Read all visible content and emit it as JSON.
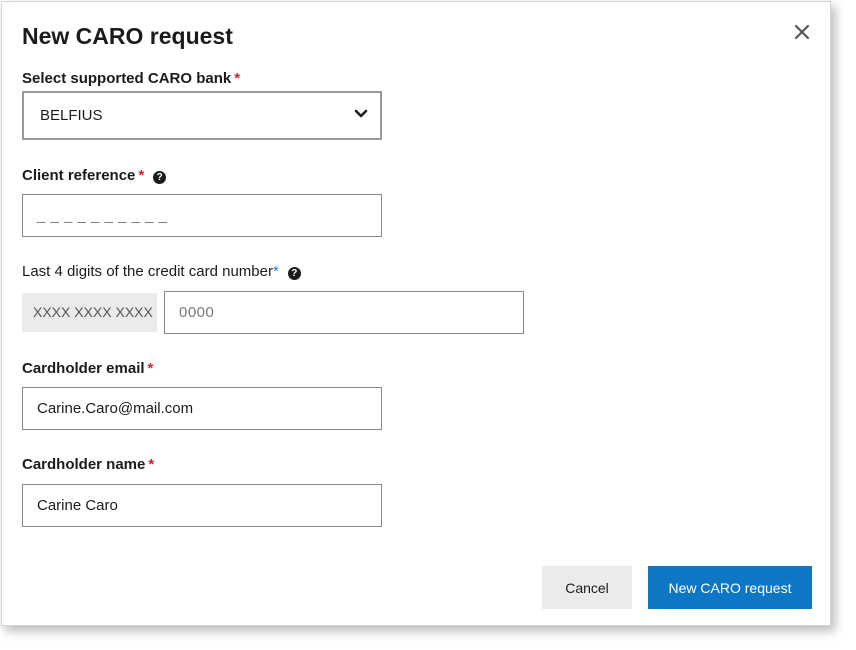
{
  "dialog": {
    "title": "New CARO request",
    "close_icon": "close-icon"
  },
  "form": {
    "bank": {
      "label": "Select supported CARO bank",
      "required_mark": "*",
      "value": "BELFIUS",
      "icon": "chevron-down-icon"
    },
    "client_reference": {
      "label": "Client reference",
      "required_mark": "*",
      "placeholder": "_ _ _ _ _ _ _ _ _ _",
      "help_icon": "question-circle-icon"
    },
    "card_digits": {
      "label": "Last 4 digits of the credit card number",
      "required_mark": "*",
      "prefix": "XXXX XXXX XXXX",
      "placeholder": "0000",
      "help_icon": "question-circle-icon"
    },
    "cardholder_email": {
      "label": "Cardholder email",
      "required_mark": "*",
      "value": "Carine.Caro@mail.com"
    },
    "cardholder_name": {
      "label": "Cardholder name",
      "required_mark": "*",
      "value": "Carine Caro"
    }
  },
  "actions": {
    "cancel_label": "Cancel",
    "submit_label": "New CARO request"
  },
  "colors": {
    "primary": "#0d77c6",
    "required": "#d1222b",
    "required_alt": "#1d86c8",
    "secondary_button": "#ebebeb"
  }
}
